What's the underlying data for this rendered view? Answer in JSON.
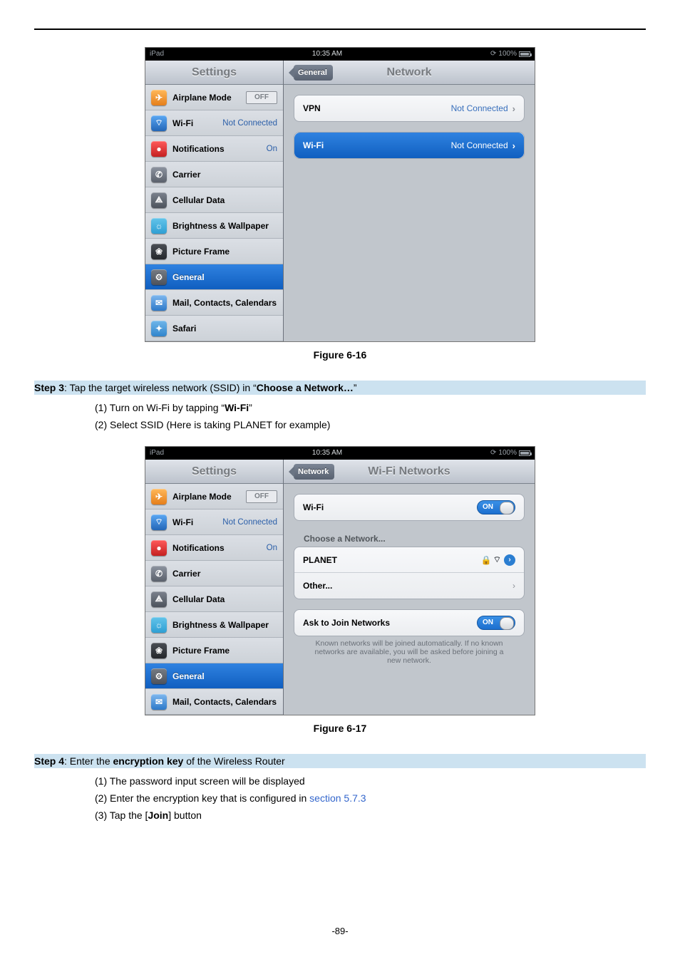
{
  "page_number": "-89-",
  "fig1_caption": "Figure 6-16",
  "fig2_caption": "Figure 6-17",
  "step3": {
    "label": "Step 3",
    "text_prefix": ": Tap the target wireless network (SSID) in “",
    "bold": "Choose a Network…",
    "text_suffix": "”",
    "item1_prefix": "(1)  Turn on Wi-Fi by tapping “",
    "item1_bold": "Wi-Fi",
    "item1_suffix": "”",
    "item2": "(2)  Select SSID (Here is taking PLANET for example)"
  },
  "step4": {
    "label": "Step 4",
    "text_prefix": ": Enter the ",
    "bold": "encryption key",
    "text_suffix": " of the Wireless Router",
    "item1": "(1)  The password input screen will be displayed",
    "item2_prefix": "(2)  Enter the encryption key that is configured in ",
    "item2_link": "section 5.7.3",
    "item3_prefix": "(3)  Tap the [",
    "item3_bold": "Join",
    "item3_suffix": "] button"
  },
  "shot1": {
    "status_left": "iPad",
    "status_time": "10:35 AM",
    "status_batt": "100%",
    "settings_title": "Settings",
    "rows": {
      "airplane": "Airplane Mode",
      "airplane_state": "OFF",
      "wifi": "Wi-Fi",
      "wifi_state": "Not Connected",
      "notifications": "Notifications",
      "notifications_state": "On",
      "carrier": "Carrier",
      "cellular": "Cellular Data",
      "brightness": "Brightness & Wallpaper",
      "picture": "Picture Frame",
      "general": "General",
      "mail": "Mail, Contacts, Calendars",
      "safari": "Safari"
    },
    "detail": {
      "back": "General",
      "title": "Network",
      "vpn_label": "VPN",
      "vpn_value": "Not Connected",
      "wifi_label": "Wi-Fi",
      "wifi_value": "Not Connected"
    }
  },
  "shot2": {
    "status_left": "iPad",
    "status_time": "10:35 AM",
    "status_batt": "100%",
    "settings_title": "Settings",
    "rows": {
      "airplane": "Airplane Mode",
      "airplane_state": "OFF",
      "wifi": "Wi-Fi",
      "wifi_state": "Not Connected",
      "notifications": "Notifications",
      "notifications_state": "On",
      "carrier": "Carrier",
      "cellular": "Cellular Data",
      "brightness": "Brightness & Wallpaper",
      "picture": "Picture Frame",
      "general": "General",
      "mail": "Mail, Contacts, Calendars"
    },
    "detail": {
      "back": "Network",
      "title": "Wi-Fi Networks",
      "wifi_label": "Wi-Fi",
      "wifi_switch": "ON",
      "choose_header": "Choose a Network...",
      "network1": "PLANET",
      "other": "Other...",
      "ask_label": "Ask to Join Networks",
      "ask_switch": "ON",
      "ask_note": "Known networks will be joined automatically. If no known networks are available, you will be asked before joining a new network."
    }
  }
}
